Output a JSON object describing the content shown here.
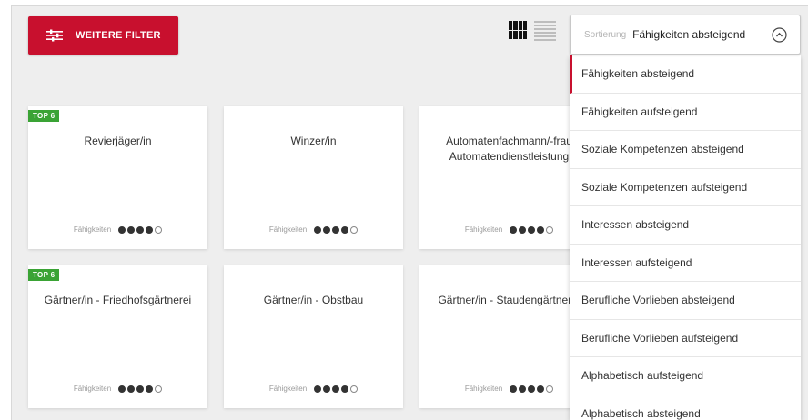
{
  "toolbar": {
    "filter_button_label": "WEITERE FILTER",
    "filter_icon": "sliders-icon",
    "grid_view_icon": "grid-view-icon",
    "list_view_icon": "list-view-icon"
  },
  "sort": {
    "label": "Sortierung",
    "selected": "Fähigkeiten absteigend",
    "chevron_icon": "chevron-up-circle-icon",
    "options": [
      "Fähigkeiten absteigend",
      "Fähigkeiten aufsteigend",
      "Soziale Kompetenzen absteigend",
      "Soziale Kompetenzen aufsteigend",
      "Interessen absteigend",
      "Interessen aufsteigend",
      "Berufliche Vorlieben absteigend",
      "Berufliche Vorlieben aufsteigend",
      "Alphabetisch aufsteigend",
      "Alphabetisch absteigend"
    ]
  },
  "cards": [
    {
      "title": "Revierjäger/in",
      "badge": "TOP 6",
      "skill_label": "Fähigkeiten",
      "rating": 4,
      "max": 5
    },
    {
      "title": "Winzer/in",
      "badge": "",
      "skill_label": "Fähigkeiten",
      "rating": 4,
      "max": 5
    },
    {
      "title": "Automatenfachmann/-frau\nAutomatendienstleistung",
      "badge": "",
      "skill_label": "Fähigkeiten",
      "rating": 4,
      "max": 5
    },
    {
      "title": "Gärtner/in - Friedhofsgärtnerei",
      "badge": "TOP 6",
      "skill_label": "Fähigkeiten",
      "rating": 4,
      "max": 5
    },
    {
      "title": "Gärtner/in - Obstbau",
      "badge": "",
      "skill_label": "Fähigkeiten",
      "rating": 4,
      "max": 5
    },
    {
      "title": "Gärtner/in - Staudengärtnerei",
      "badge": "",
      "skill_label": "Fähigkeiten",
      "rating": 4,
      "max": 5
    }
  ],
  "colors": {
    "accent": "#c8102e",
    "badge": "#3aa335"
  }
}
